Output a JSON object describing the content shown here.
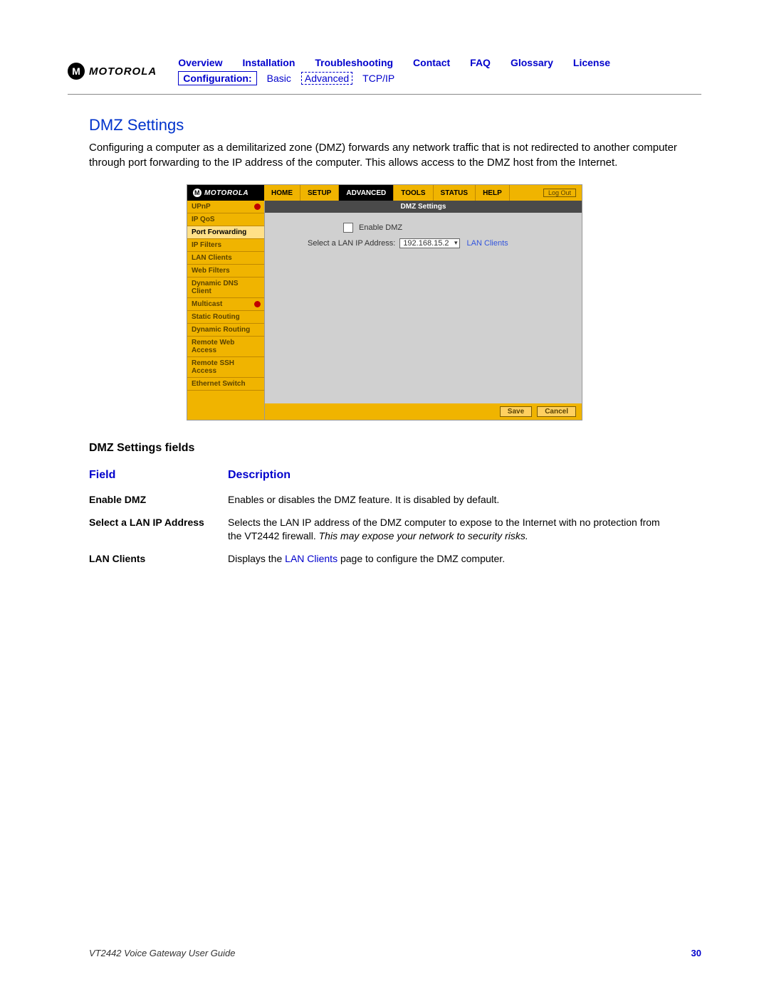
{
  "brand": "MOTOROLA",
  "nav": {
    "top": [
      "Overview",
      "Installation",
      "Troubleshooting",
      "Contact",
      "FAQ",
      "Glossary",
      "License"
    ],
    "config_label": "Configuration:",
    "sub": [
      "Basic",
      "Advanced",
      "TCP/IP"
    ]
  },
  "section": {
    "title": "DMZ Settings",
    "intro": "Configuring a computer as a demilitarized zone (DMZ) forwards any network traffic that is not redirected to another computer through port forwarding to the IP address of the computer. This allows access to the DMZ host from the Internet."
  },
  "ui": {
    "brand": "MOTOROLA",
    "tabs": [
      "HOME",
      "SETUP",
      "ADVANCED",
      "TOOLS",
      "STATUS",
      "HELP"
    ],
    "active_tab": "ADVANCED",
    "logout": "Log Out",
    "sidebar": [
      "UPnP",
      "IP QoS",
      "Port Forwarding",
      "IP Filters",
      "LAN Clients",
      "Web Filters",
      "Dynamic DNS Client",
      "Multicast",
      "Static Routing",
      "Dynamic Routing",
      "Remote Web Access",
      "Remote SSH Access",
      "Ethernet Switch"
    ],
    "sidebar_selected": "Port Forwarding",
    "main_title": "DMZ Settings",
    "enable_label": "Enable DMZ",
    "select_label": "Select a LAN IP Address:",
    "select_value": "192.168.15.2",
    "lan_clients_link": "LAN Clients",
    "save": "Save",
    "cancel": "Cancel"
  },
  "fields_heading": "DMZ Settings fields",
  "table": {
    "head": [
      "Field",
      "Description"
    ],
    "rows": [
      {
        "field": "Enable DMZ",
        "desc": "Enables or disables the DMZ feature. It is disabled by default."
      },
      {
        "field": "Select a LAN IP Address",
        "desc_pre": "Selects the LAN IP address of the DMZ computer to expose to the Internet with no protection from the VT2442 firewall. ",
        "desc_italic": "This may expose your network to security risks."
      },
      {
        "field": "LAN Clients",
        "desc_pre": "Displays the ",
        "desc_link": "LAN Clients",
        "desc_post": " page to configure the DMZ computer."
      }
    ]
  },
  "footer": {
    "title": "VT2442 Voice Gateway User Guide",
    "page": "30"
  }
}
